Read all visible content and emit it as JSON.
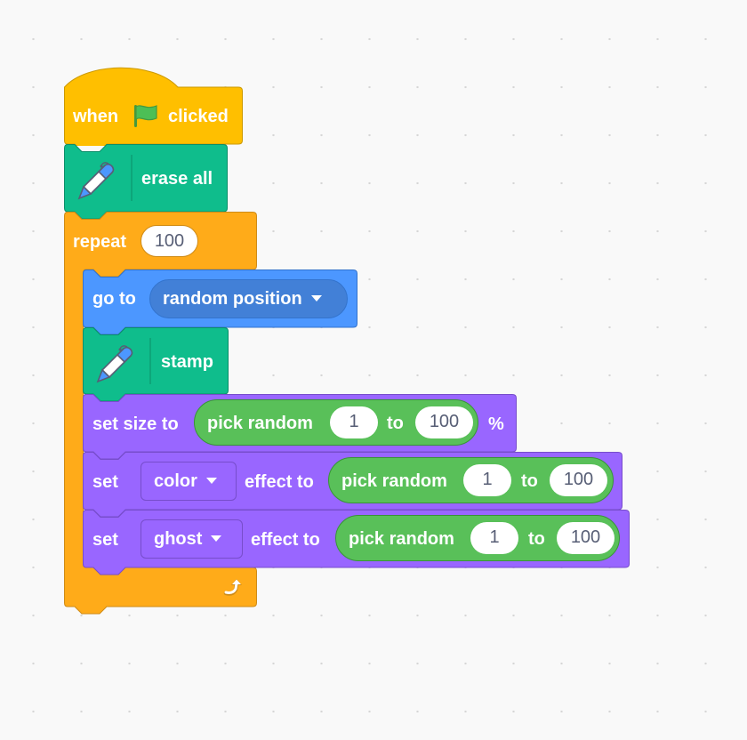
{
  "workspace": {
    "script": {
      "hat": {
        "label_before": "when",
        "label_after": "clicked",
        "icon": "green-flag-icon"
      },
      "erase_all": {
        "label": "erase all",
        "icon": "pen-icon",
        "category": "pen"
      },
      "repeat": {
        "label": "repeat",
        "count": "100",
        "loop_icon": "repeat-arrow-icon"
      },
      "go_to": {
        "label": "go to",
        "target": "random position"
      },
      "stamp": {
        "label": "stamp",
        "icon": "pen-icon"
      },
      "set_size": {
        "label": "set size to",
        "reporter": {
          "label": "pick random",
          "from": "1",
          "to_label": "to",
          "to": "100"
        },
        "suffix": "%"
      },
      "set_color_effect": {
        "label": "set",
        "effect": "color",
        "label2": "effect to",
        "reporter": {
          "label": "pick random",
          "from": "1",
          "to_label": "to",
          "to": "100"
        }
      },
      "set_ghost_effect": {
        "label": "set",
        "effect": "ghost",
        "label2": "effect to",
        "reporter": {
          "label": "pick random",
          "from": "1",
          "to_label": "to",
          "to": "100"
        }
      }
    },
    "colors": {
      "events": "#FFBF00",
      "pen": "#0FBD8C",
      "control": "#FFAB19",
      "motion": "#4C97FF",
      "motion_dark": "#4280D7",
      "looks": "#9966FF",
      "operators": "#59C059",
      "background": "#F9F9F9"
    }
  }
}
